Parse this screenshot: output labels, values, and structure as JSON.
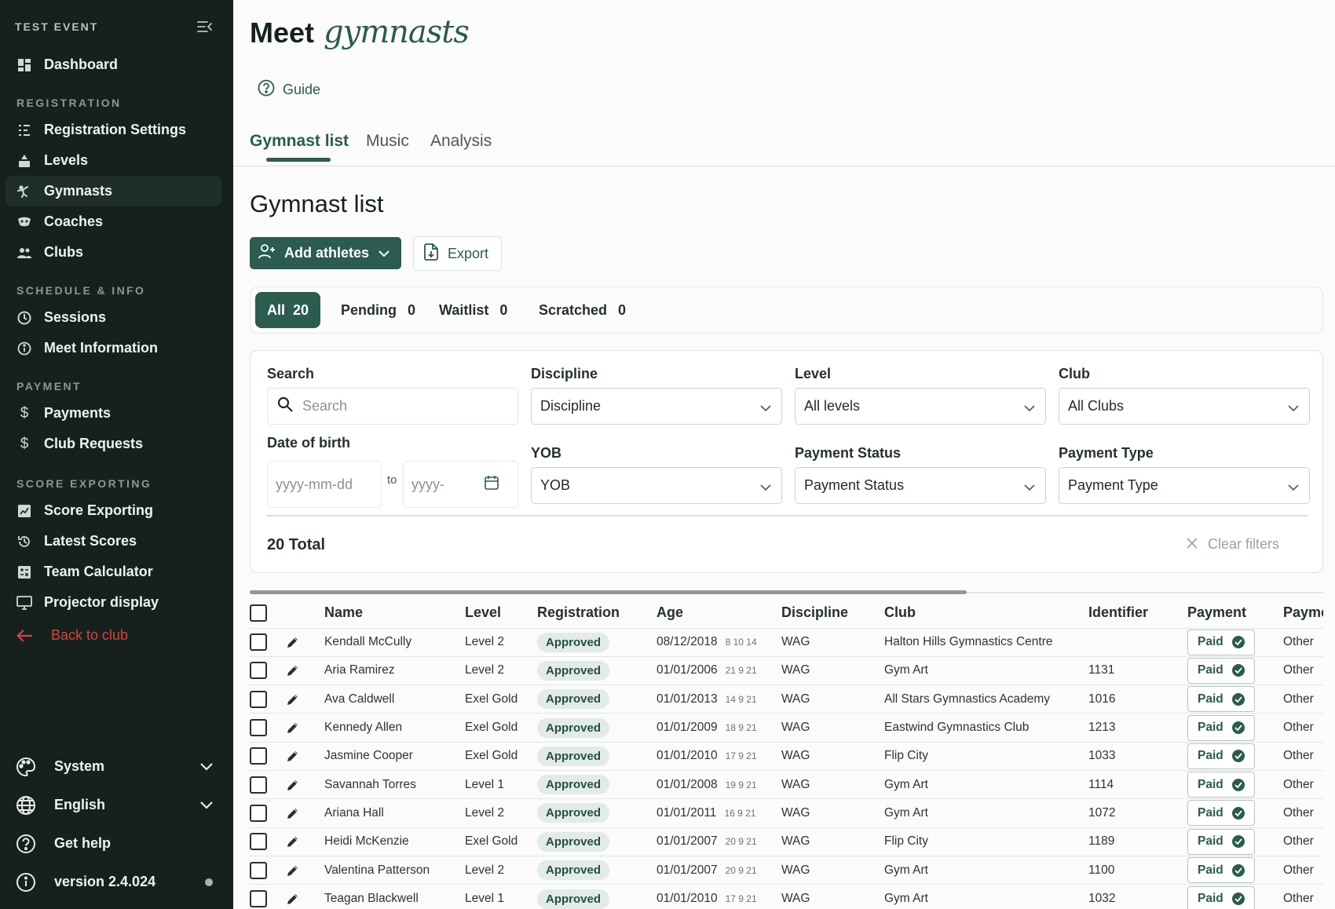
{
  "sidebar": {
    "event_name": "TEST EVENT",
    "dashboard": "Dashboard",
    "sections": {
      "registration": "REGISTRATION",
      "schedule": "SCHEDULE & INFO",
      "payment": "PAYMENT",
      "score_exporting": "SCORE EXPORTING"
    },
    "registration_items": [
      "Registration Settings",
      "Levels",
      "Gymnasts",
      "Coaches",
      "Clubs"
    ],
    "schedule_items": [
      "Sessions",
      "Meet Information"
    ],
    "payment_items": [
      "Payments",
      "Club Requests"
    ],
    "score_items": [
      "Score Exporting",
      "Latest Scores",
      "Team Calculator",
      "Projector display"
    ],
    "back": "Back to club",
    "bottom": {
      "system": "System",
      "language": "English",
      "help": "Get help",
      "version": "version 2.4.024"
    },
    "active_item": "Gymnasts",
    "colors": {
      "bg": "#16211f",
      "back": "#d2463f"
    }
  },
  "header": {
    "title_bold": "Meet",
    "title_script": "gymnasts",
    "guide": "Guide"
  },
  "tabs": [
    "Gymnast list",
    "Music",
    "Analysis"
  ],
  "active_tab": "Gymnast list",
  "page_title": "Gymnast list",
  "actions": {
    "add": "Add athletes",
    "export": "Export"
  },
  "status_tabs": [
    {
      "label": "All",
      "count": "20"
    },
    {
      "label": "Pending",
      "count": "0"
    },
    {
      "label": "Waitlist",
      "count": "0"
    },
    {
      "label": "Scratched",
      "count": "0"
    }
  ],
  "filters": {
    "search_label": "Search",
    "search_placeholder": "Search",
    "discipline_label": "Discipline",
    "discipline_value": "Discipline",
    "level_label": "Level",
    "level_value": "All levels",
    "club_label": "Club",
    "club_value": "All Clubs",
    "dob_label": "Date of birth",
    "dob_from_placeholder": "yyyy-mm-dd",
    "dob_to_label": "to",
    "dob_to_placeholder": "yyyy-",
    "yob_label": "YOB",
    "yob_value": "YOB",
    "payment_status_label": "Payment Status",
    "payment_status_value": "Payment Status",
    "payment_type_label": "Payment Type",
    "payment_type_value": "Payment Type",
    "total": "20 Total",
    "clear": "Clear filters"
  },
  "table": {
    "columns": [
      "Name",
      "Level",
      "Registration",
      "Age",
      "Discipline",
      "Club",
      "Identifier",
      "Payment",
      "Payme"
    ],
    "rows": [
      {
        "name": "Kendall McCully",
        "level": "Level 2",
        "registration": "Approved",
        "dob": "08/12/2018",
        "ages": "8 10 14",
        "discipline": "WAG",
        "club": "Halton Hills Gymnastics Centre",
        "identifier": "",
        "payment": "Paid",
        "payment_type": "Other"
      },
      {
        "name": "Aria Ramirez",
        "level": "Level 2",
        "registration": "Approved",
        "dob": "01/01/2006",
        "ages": "21 9 21",
        "discipline": "WAG",
        "club": "Gym Art",
        "identifier": "1131",
        "payment": "Paid",
        "payment_type": "Other"
      },
      {
        "name": "Ava Caldwell",
        "level": "Exel Gold",
        "registration": "Approved",
        "dob": "01/01/2013",
        "ages": "14 9 21",
        "discipline": "WAG",
        "club": "All Stars Gymnastics Academy",
        "identifier": "1016",
        "payment": "Paid",
        "payment_type": "Other"
      },
      {
        "name": "Kennedy Allen",
        "level": "Exel Gold",
        "registration": "Approved",
        "dob": "01/01/2009",
        "ages": "18 9 21",
        "discipline": "WAG",
        "club": "Eastwind Gymnastics Club",
        "identifier": "1213",
        "payment": "Paid",
        "payment_type": "Other"
      },
      {
        "name": "Jasmine Cooper",
        "level": "Exel Gold",
        "registration": "Approved",
        "dob": "01/01/2010",
        "ages": "17 9 21",
        "discipline": "WAG",
        "club": "Flip City",
        "identifier": "1033",
        "payment": "Paid",
        "payment_type": "Other"
      },
      {
        "name": "Savannah Torres",
        "level": "Level 1",
        "registration": "Approved",
        "dob": "01/01/2008",
        "ages": "19 9 21",
        "discipline": "WAG",
        "club": "Gym Art",
        "identifier": "1114",
        "payment": "Paid",
        "payment_type": "Other"
      },
      {
        "name": "Ariana Hall",
        "level": "Level 2",
        "registration": "Approved",
        "dob": "01/01/2011",
        "ages": "16 9 21",
        "discipline": "WAG",
        "club": "Gym Art",
        "identifier": "1072",
        "payment": "Paid",
        "payment_type": "Other"
      },
      {
        "name": "Heidi McKenzie",
        "level": "Exel Gold",
        "registration": "Approved",
        "dob": "01/01/2007",
        "ages": "20 9 21",
        "discipline": "WAG",
        "club": "Flip City",
        "identifier": "1189",
        "payment": "Paid",
        "payment_type": "Other"
      },
      {
        "name": "Valentina Patterson",
        "level": "Level 2",
        "registration": "Approved",
        "dob": "01/01/2007",
        "ages": "20 9 21",
        "discipline": "WAG",
        "club": "Gym Art",
        "identifier": "1100",
        "payment": "Paid",
        "payment_type": "Other"
      },
      {
        "name": "Teagan Blackwell",
        "level": "Level 1",
        "registration": "Approved",
        "dob": "01/01/2010",
        "ages": "17 9 21",
        "discipline": "WAG",
        "club": "Gym Art",
        "identifier": "1032",
        "payment": "Paid",
        "payment_type": "Other"
      }
    ]
  },
  "colors": {
    "accent": "#2c5b4f",
    "approved_bg": "#e3ebe6"
  },
  "icons": [
    "dashboard-icon",
    "registration-settings-icon",
    "levels-icon",
    "gymnasts-icon",
    "coaches-icon",
    "clubs-icon",
    "clock-icon",
    "info-icon",
    "dollar-icon",
    "score-export-icon",
    "latest-scores-icon",
    "calculator-icon",
    "monitor-icon",
    "arrow-left-icon",
    "palette-icon",
    "globe-icon",
    "help-icon",
    "search-icon",
    "calendar-icon",
    "chevron-down-icon",
    "close-icon",
    "pencil-icon",
    "check-icon",
    "user-plus-icon",
    "file-export-icon",
    "collapse-menu-icon"
  ]
}
